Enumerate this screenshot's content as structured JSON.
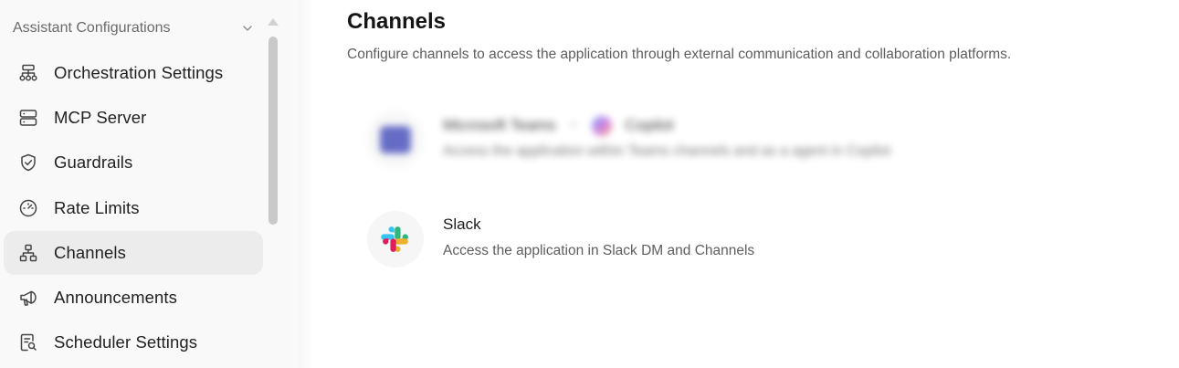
{
  "sidebar": {
    "section_title": "Assistant Configurations",
    "items": [
      {
        "label": "Orchestration Settings",
        "icon": "hierarchy-icon"
      },
      {
        "label": "MCP Server",
        "icon": "server-icon"
      },
      {
        "label": "Guardrails",
        "icon": "shield-icon"
      },
      {
        "label": "Rate Limits",
        "icon": "gauge-icon"
      },
      {
        "label": "Channels",
        "icon": "network-icon",
        "active": true
      },
      {
        "label": "Announcements",
        "icon": "megaphone-icon"
      },
      {
        "label": "Scheduler Settings",
        "icon": "document-search-icon"
      }
    ]
  },
  "main": {
    "title": "Channels",
    "subtitle": "Configure channels to access the application through external communication and collaboration platforms.",
    "channels": [
      {
        "name": "Microsoft Teams",
        "secondary_name": "Copilot",
        "description": "Access the application within Teams channels and as a agent in Copilot",
        "blurred": true
      },
      {
        "name": "Slack",
        "description": "Access the application in Slack DM and Channels",
        "blurred": false
      }
    ]
  },
  "colors": {
    "sidebar_bg": "#f9f9f9",
    "active_item_bg": "#ececec",
    "teams_purple": "#4b53bc",
    "slack_blue": "#36c5f0",
    "slack_green": "#2eb67d",
    "slack_red": "#e01e5a",
    "slack_yellow": "#ecb22e"
  }
}
